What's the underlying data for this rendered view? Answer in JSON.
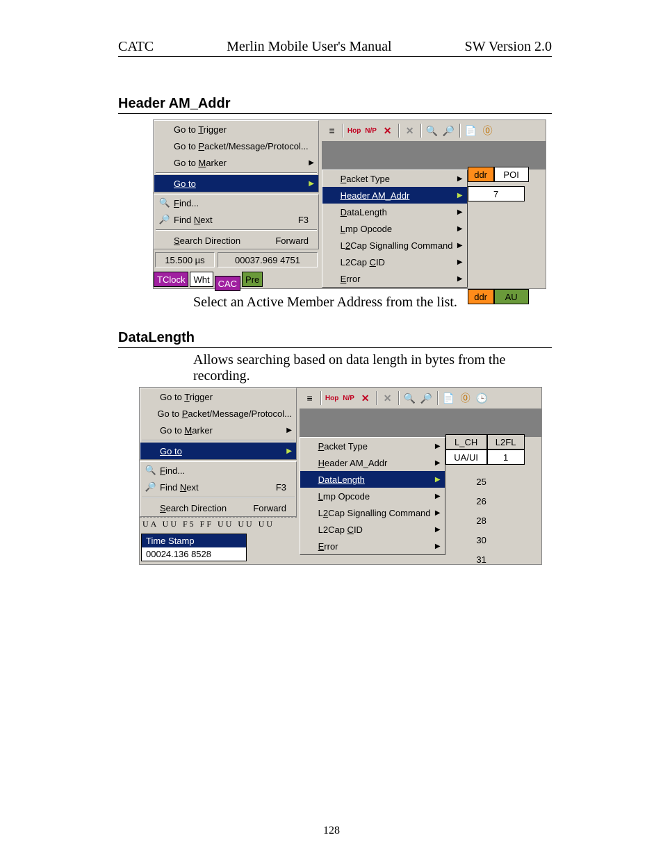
{
  "header": {
    "left": "CATC",
    "center": "Merlin Mobile User's Manual",
    "right": "SW Version 2.0"
  },
  "page_number": "128",
  "section1": {
    "title": "Header AM_Addr",
    "caption": "Select an Active Member Address from the list.",
    "left_menu": {
      "items": [
        {
          "label": "Go to Trigger",
          "u": "T"
        },
        {
          "label": "Go to Packet/Message/Protocol...",
          "u": "P"
        },
        {
          "label": "Go to Marker",
          "u": "M",
          "arrow": true
        }
      ],
      "goto": {
        "label": "Go to",
        "u": "G",
        "arrow": true,
        "hl": true
      },
      "find": {
        "label": "Find...",
        "u": "F",
        "icon": "search-icon"
      },
      "find_next": {
        "label": "Find Next",
        "u": "N",
        "accel": "F3",
        "icon": "search-next-icon"
      },
      "search_dir": {
        "label": "Search Direction",
        "u": "S",
        "value": "Forward"
      },
      "boxes": {
        "b1": "15.500 µs",
        "b2": "00037.969 4751"
      },
      "tags": {
        "t1": "TClock",
        "t2": "Wht",
        "t3": "CAC",
        "t4": "Pre"
      }
    },
    "submenu": {
      "items": [
        {
          "label": "Packet Type",
          "u": "P"
        },
        {
          "label": "Header AM_Addr",
          "u": "H",
          "hl": true
        },
        {
          "label": "DataLength",
          "u": "D"
        },
        {
          "label": "Lmp Opcode",
          "u": "L"
        },
        {
          "label": "L2Cap Signalling Command",
          "u": "2"
        },
        {
          "label": "L2Cap CID",
          "u": "C"
        },
        {
          "label": "Error",
          "u": "E"
        }
      ]
    },
    "sidecells": [
      [
        {
          "t": "ddr",
          "cls": "orange"
        },
        {
          "t": "POI"
        }
      ],
      [
        {
          "t": ""
        },
        {
          "t": "7"
        }
      ],
      [
        {
          "t": "ddr",
          "cls": "orange"
        },
        {
          "t": "AU",
          "cls": "green"
        }
      ]
    ]
  },
  "section2": {
    "title": "DataLength",
    "intro": "Allows searching based on data length in bytes from the recording.",
    "left_menu": {
      "items": [
        {
          "label": "Go to Trigger",
          "u": "T"
        },
        {
          "label": "Go to Packet/Message/Protocol...",
          "u": "P"
        },
        {
          "label": "Go to Marker",
          "u": "M",
          "arrow": true
        }
      ],
      "goto": {
        "label": "Go to",
        "u": "G",
        "arrow": true,
        "hl": true
      },
      "find": {
        "label": "Find...",
        "u": "F",
        "icon": "search-icon"
      },
      "find_next": {
        "label": "Find Next",
        "u": "N",
        "accel": "F3",
        "icon": "search-next-icon"
      },
      "search_dir": {
        "label": "Search Direction",
        "u": "S",
        "value": "Forward"
      },
      "hexrow": "UA  UU  F5  FF  UU  UU  UU",
      "ts_label": "Time Stamp",
      "ts_value": "00024.136 8528"
    },
    "submenu": {
      "items": [
        {
          "label": "Packet Type",
          "u": "P"
        },
        {
          "label": "Header AM_Addr",
          "u": "H"
        },
        {
          "label": "DataLength",
          "u": "D",
          "hl": true
        },
        {
          "label": "Lmp Opcode",
          "u": "L"
        },
        {
          "label": "L2Cap Signalling Command",
          "u": "2"
        },
        {
          "label": "L2Cap CID",
          "u": "C"
        },
        {
          "label": "Error",
          "u": "E"
        }
      ]
    },
    "sidecells_header": [
      "L_CH",
      "L2FL"
    ],
    "sidecells_row": [
      "UA/UI",
      "1"
    ],
    "value_list": [
      "25",
      "26",
      "28",
      "30",
      "31"
    ]
  },
  "toolbar_icons": [
    "list-icon",
    "hop-icon",
    "np-icon",
    "x1-icon",
    "x2-icon",
    "mag-icon",
    "mag2-icon",
    "note-icon",
    "warn-icon",
    "clock-icon"
  ]
}
